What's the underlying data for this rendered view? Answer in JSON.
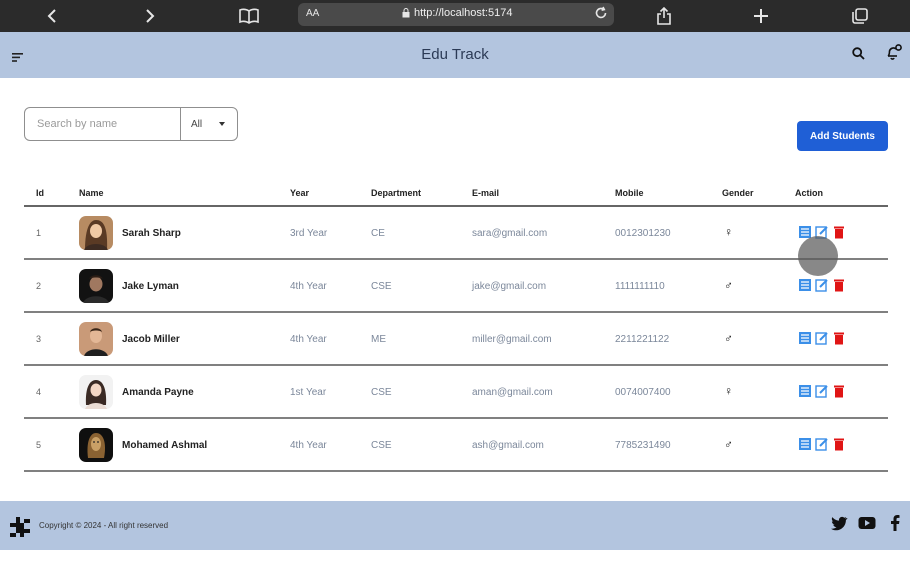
{
  "browser": {
    "text_size": "AA",
    "url": "http://localhost:5174",
    "icons": [
      "back-icon",
      "forward-icon",
      "book-icon",
      "lock-icon",
      "reload-icon",
      "share-icon",
      "plus-icon",
      "tabs-icon"
    ]
  },
  "header": {
    "title": "Edu Track",
    "icons": [
      "menu-icon",
      "search-icon",
      "bell-icon"
    ]
  },
  "controls": {
    "search_placeholder": "Search by name",
    "filter_value": "All",
    "add_button": "Add Students"
  },
  "table": {
    "columns": [
      "Id",
      "Name",
      "Year",
      "Department",
      "E-mail",
      "Mobile",
      "Gender",
      "Action"
    ],
    "rows": [
      {
        "id": "1",
        "name": "Sarah Sharp",
        "year": "3rd Year",
        "department": "CE",
        "email": "sara@gmail.com",
        "mobile": "0012301230",
        "gender": "♀",
        "gender_word": "female"
      },
      {
        "id": "2",
        "name": "Jake Lyman",
        "year": "4th Year",
        "department": "CSE",
        "email": "jake@gmail.com",
        "mobile": "1111111110",
        "gender": "♂",
        "gender_word": "male"
      },
      {
        "id": "3",
        "name": "Jacob Miller",
        "year": "4th Year",
        "department": "ME",
        "email": "miller@gmail.com",
        "mobile": "2211221122",
        "gender": "♂",
        "gender_word": "male"
      },
      {
        "id": "4",
        "name": "Amanda Payne",
        "year": "1st Year",
        "department": "CSE",
        "email": "aman@gmail.com",
        "mobile": "0074007400",
        "gender": "♀",
        "gender_word": "female"
      },
      {
        "id": "5",
        "name": "Mohamed Ashmal",
        "year": "4th Year",
        "department": "CSE",
        "email": "ash@gmail.com",
        "mobile": "7785231490",
        "gender": "♂",
        "gender_word": "male"
      }
    ],
    "action_icons": [
      "view-icon",
      "edit-icon",
      "delete-icon"
    ]
  },
  "footer": {
    "copyright": "Copyright © 2024 - All right reserved",
    "social_icons": [
      "twitter-icon",
      "youtube-icon",
      "facebook-icon"
    ]
  },
  "colors": {
    "header_bg": "#b3c5df",
    "primary": "#1f5fd6",
    "view": "#3b8fe8",
    "delete": "#e01515"
  }
}
